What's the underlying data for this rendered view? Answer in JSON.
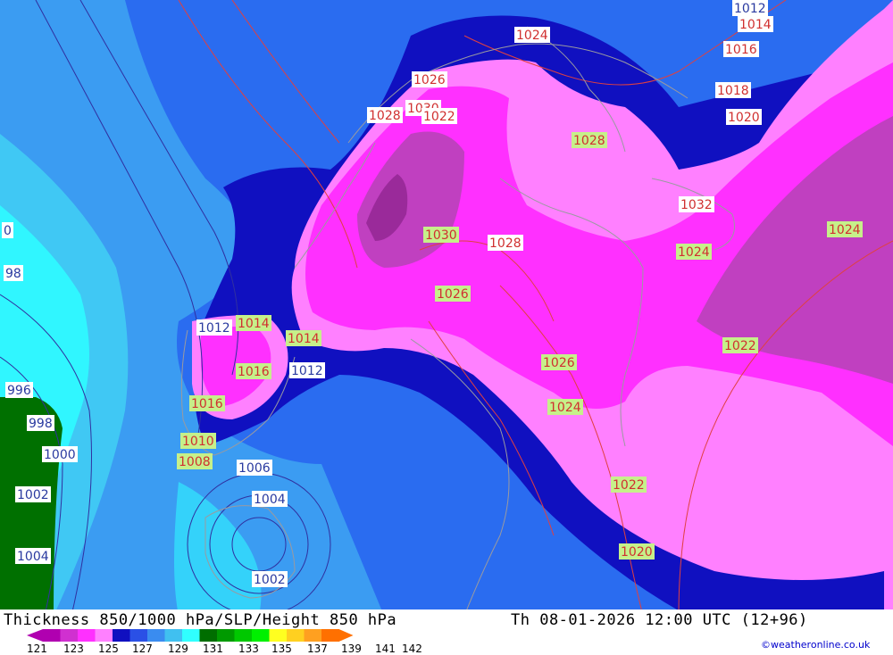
{
  "title": "Thickness 850/1000 hPa/SLP/Height 850 hPa",
  "valid_time": "Th 08-01-2026 12:00 UTC (12+96)",
  "credit": "©weatheronline.co.uk",
  "colorbar": {
    "ticks": [
      "121",
      "123",
      "125",
      "127",
      "129",
      "131",
      "133",
      "135",
      "137",
      "139",
      "141",
      "142"
    ],
    "colors": [
      "#b000b0",
      "#d030d0",
      "#ff30ff",
      "#ff80ff",
      "#1010c0",
      "#2a50e6",
      "#3a8cf0",
      "#40c0f0",
      "#30ffff",
      "#006e00",
      "#009a00",
      "#00c800",
      "#00f000",
      "#ffff20",
      "#ffd020",
      "#ffa020",
      "#ff7000"
    ]
  },
  "contour_labels": [
    {
      "text": "1012",
      "kind": "blue"
    },
    {
      "text": "1014",
      "kind": "red"
    },
    {
      "text": "1016",
      "kind": "red"
    },
    {
      "text": "1018",
      "kind": "red"
    },
    {
      "text": "1020",
      "kind": "red"
    },
    {
      "text": "1024",
      "kind": "red"
    },
    {
      "text": "1026",
      "kind": "red"
    },
    {
      "text": "1028",
      "kind": "red"
    },
    {
      "text": "1032",
      "kind": "red"
    },
    {
      "text": "1030",
      "kind": "red"
    },
    {
      "text": "1028",
      "kind": "green"
    },
    {
      "text": "1030",
      "kind": "green"
    },
    {
      "text": "1028",
      "kind": "red"
    },
    {
      "text": "1022",
      "kind": "red"
    },
    {
      "text": "1024",
      "kind": "green"
    },
    {
      "text": "1024",
      "kind": "green"
    },
    {
      "text": "1026",
      "kind": "green"
    },
    {
      "text": "1022",
      "kind": "green"
    },
    {
      "text": "1026",
      "kind": "green"
    },
    {
      "text": "1024",
      "kind": "green"
    },
    {
      "text": "1022",
      "kind": "green"
    },
    {
      "text": "1020",
      "kind": "green"
    },
    {
      "text": "1012",
      "kind": "blue"
    },
    {
      "text": "1014",
      "kind": "green"
    },
    {
      "text": "1014",
      "kind": "green"
    },
    {
      "text": "1016",
      "kind": "green"
    },
    {
      "text": "1012",
      "kind": "blue"
    },
    {
      "text": "1016",
      "kind": "green"
    },
    {
      "text": "1010",
      "kind": "green"
    },
    {
      "text": "1008",
      "kind": "green"
    },
    {
      "text": "1006",
      "kind": "blue"
    },
    {
      "text": "1004",
      "kind": "blue"
    },
    {
      "text": "1002",
      "kind": "blue"
    },
    {
      "text": "0",
      "kind": "blue"
    },
    {
      "text": "98",
      "kind": "blue"
    },
    {
      "text": "996",
      "kind": "blue"
    },
    {
      "text": "998",
      "kind": "blue"
    },
    {
      "text": "1000",
      "kind": "blue"
    },
    {
      "text": "1002",
      "kind": "blue"
    },
    {
      "text": "1004",
      "kind": "blue"
    }
  ]
}
